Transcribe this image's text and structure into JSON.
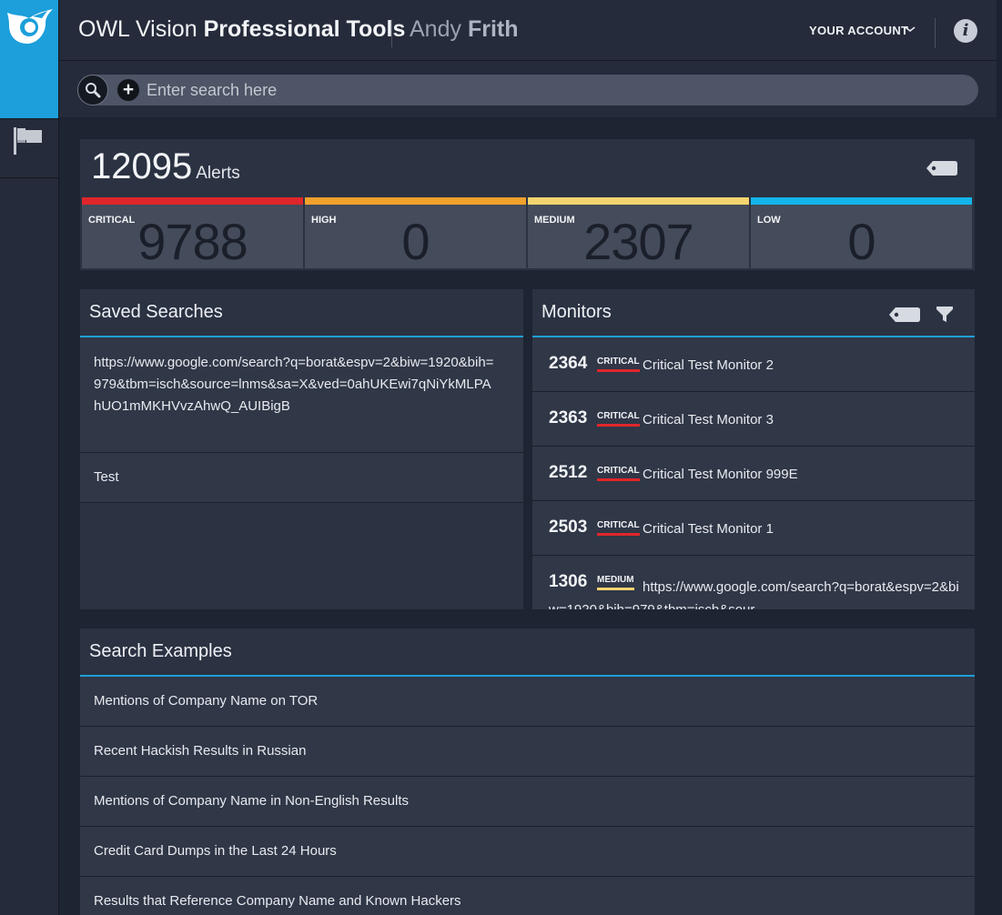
{
  "header": {
    "app_name_light": "OWL Vision",
    "app_name_bold": "Professional Tools",
    "user_first": "Andy",
    "user_last": "Frith",
    "account_label": "YOUR ACCOUNT",
    "info_label": "i"
  },
  "search": {
    "placeholder": "Enter search here",
    "add_label": "+"
  },
  "alerts": {
    "total": "12095",
    "label": "Alerts",
    "severities": [
      {
        "label": "CRITICAL",
        "count": "9788",
        "color": "#e0262a"
      },
      {
        "label": "HIGH",
        "count": "0",
        "color": "#f2a12c"
      },
      {
        "label": "MEDIUM",
        "count": "2307",
        "color": "#f3d46e"
      },
      {
        "label": "LOW",
        "count": "0",
        "color": "#13b5ea"
      }
    ]
  },
  "saved_searches": {
    "title": "Saved Searches",
    "items": [
      "https://www.google.com/search?q=borat&espv=2&biw=1920&bih=979&tbm=isch&source=lnms&sa=X&ved=0ahUKEwi7qNiYkMLPAhUO1mMKHVvzAhwQ_AUIBigB",
      "Test"
    ]
  },
  "monitors": {
    "title": "Monitors",
    "items": [
      {
        "count": "2364",
        "severity": "CRITICAL",
        "name": "Critical Test Monitor 2"
      },
      {
        "count": "2363",
        "severity": "CRITICAL",
        "name": "Critical Test Monitor 3"
      },
      {
        "count": "2512",
        "severity": "CRITICAL",
        "name": "Critical Test Monitor 999E"
      },
      {
        "count": "2503",
        "severity": "CRITICAL",
        "name": "Critical Test Monitor 1"
      },
      {
        "count": "1306",
        "severity": "MEDIUM",
        "name": "https://www.google.com/search?q=borat&espv=2&biw=1920&bih=979&tbm=isch&sour"
      }
    ]
  },
  "search_examples": {
    "title": "Search Examples",
    "items": [
      "Mentions of Company Name on TOR",
      "Recent Hackish Results in Russian",
      "Mentions of Company Name in Non-English Results",
      "Credit Card Dumps in the Last 24 Hours",
      "Results that Reference Company Name and Known Hackers"
    ]
  },
  "colors": {
    "accent": "#1c9fda",
    "critical": "#e0262a",
    "high": "#f2a12c",
    "medium": "#f3d46e",
    "low": "#13b5ea"
  }
}
